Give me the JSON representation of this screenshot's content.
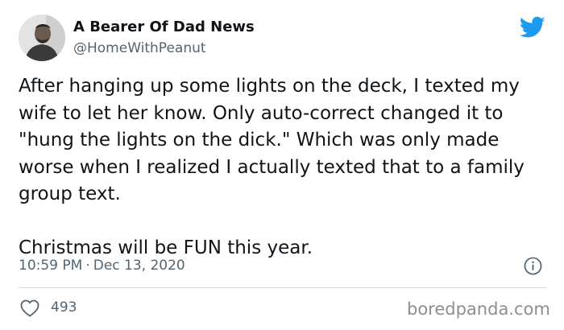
{
  "author": {
    "display_name": "A Bearer Of Dad News",
    "handle": "@HomeWithPeanut"
  },
  "tweet": {
    "paragraphs": [
      "After hanging up some lights on the deck, I texted my wife to let her know. Only auto-correct changed it to \"hung the lights on the dick.\" Which was only made worse when I realized I actually texted that to a family group text.",
      "Christmas will be FUN this year."
    ],
    "time": "10:59 PM",
    "separator": "·",
    "date": "Dec 13, 2020",
    "likes": "493"
  },
  "icons": {
    "brand": "twitter-bird-icon",
    "info": "info-icon",
    "like": "heart-icon"
  },
  "colors": {
    "twitter_blue": "#1d9bf0",
    "text_primary": "#0f1419",
    "text_secondary": "#536471"
  },
  "watermark": "boredpanda.com"
}
